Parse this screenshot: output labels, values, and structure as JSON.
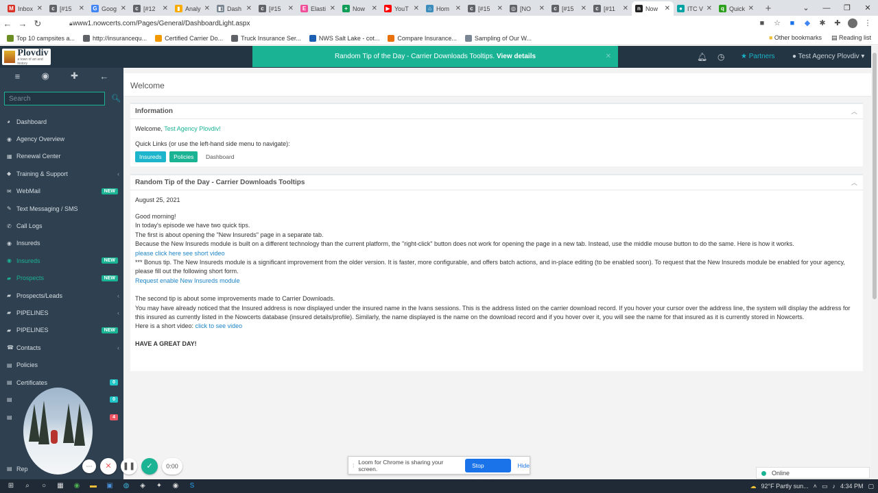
{
  "browser": {
    "tabs": [
      {
        "icon": "gmail-icon",
        "label": "Inbox",
        "color": "#d93025",
        "glyph": "M"
      },
      {
        "icon": "nowcerts-icon",
        "label": "[#15",
        "color": "#5f6368",
        "glyph": "c"
      },
      {
        "icon": "google-icon",
        "label": "Goog",
        "color": "#4285f4",
        "glyph": "G"
      },
      {
        "icon": "nowcerts-icon",
        "label": "[#12",
        "color": "#5f6368",
        "glyph": "c"
      },
      {
        "icon": "analytics-icon",
        "label": "Analy",
        "color": "#f9ab00",
        "glyph": "▮"
      },
      {
        "icon": "dashboard-icon",
        "label": "Dash",
        "color": "#7a8691",
        "glyph": "◧"
      },
      {
        "icon": "nowcerts-icon",
        "label": "[#15",
        "color": "#5f6368",
        "glyph": "c"
      },
      {
        "icon": "elastic-icon",
        "label": "Elasti",
        "color": "#f04e98",
        "glyph": "E"
      },
      {
        "icon": "sheets-icon",
        "label": "Now",
        "color": "#0f9d58",
        "glyph": "+"
      },
      {
        "icon": "youtube-icon",
        "label": "YouT",
        "color": "#ff0000",
        "glyph": "▶"
      },
      {
        "icon": "home-icon",
        "label": "Hom",
        "color": "#3c8dbc",
        "glyph": "⌂"
      },
      {
        "icon": "nowcerts-icon",
        "label": "[#15",
        "color": "#5f6368",
        "glyph": "c"
      },
      {
        "icon": "globe-icon",
        "label": "[NO",
        "color": "#5f6368",
        "glyph": "◎"
      },
      {
        "icon": "nowcerts-icon",
        "label": "[#15",
        "color": "#5f6368",
        "glyph": "c"
      },
      {
        "icon": "nowcerts-icon",
        "label": "[#11",
        "color": "#5f6368",
        "glyph": "c"
      },
      {
        "icon": "nowcerts-icon",
        "label": "Now",
        "color": "#222",
        "glyph": "n",
        "active": true
      },
      {
        "icon": "itc-icon",
        "label": "ITC V",
        "color": "#00a3a3",
        "glyph": "●"
      },
      {
        "icon": "quickbooks-icon",
        "label": "Quick",
        "color": "#2ca01c",
        "glyph": "q"
      }
    ],
    "url": "www1.nowcerts.com/Pages/General/DashboardLight.aspx",
    "bookmarks": [
      {
        "label": "Top 10 campsites a...",
        "color": "#6b8e23"
      },
      {
        "label": "http://insurancequ...",
        "color": "#5f6368"
      },
      {
        "label": "Certified Carrier Do...",
        "color": "#f29900"
      },
      {
        "label": "Truck Insurance Ser...",
        "color": "#5f6368"
      },
      {
        "label": "NWS Salt Lake - cot...",
        "color": "#1a5fb4"
      },
      {
        "label": "Compare Insurance...",
        "color": "#e8710a"
      },
      {
        "label": "Sampling of Our W...",
        "color": "#7a8691"
      }
    ],
    "bookmarks_right": {
      "other": "Other bookmarks",
      "reading": "Reading list"
    }
  },
  "header": {
    "logo_name": "Plovdiv",
    "logo_sub": "a town of art and history",
    "tip_text": "Random Tip of the Day - Carrier Downloads Tooltips.",
    "tip_link": "View details",
    "partners": "Partners",
    "agent": "Test Agency Plovdiv ▾"
  },
  "sidebar": {
    "search_placeholder": "Search",
    "items": [
      {
        "label": "Dashboard",
        "icon": "dashboard-icon",
        "glyph": "◕"
      },
      {
        "label": "Agency Overview",
        "icon": "globe-icon",
        "glyph": "◉"
      },
      {
        "label": "Renewal Center",
        "icon": "calendar-icon",
        "glyph": "▦"
      },
      {
        "label": "Training & Support",
        "icon": "graduation-icon",
        "glyph": "◆",
        "chev": true
      },
      {
        "label": "WebMail",
        "icon": "mail-icon",
        "glyph": "✉",
        "badge": "NEW"
      },
      {
        "label": "Text Messaging / SMS",
        "icon": "sms-icon",
        "glyph": "✎"
      },
      {
        "label": "Call Logs",
        "icon": "phone-icon",
        "glyph": "✆"
      },
      {
        "label": "Insureds",
        "icon": "eye-icon",
        "glyph": "◉"
      },
      {
        "label": "Insureds",
        "icon": "eye-icon",
        "glyph": "◉",
        "green": true,
        "badge": "NEW"
      },
      {
        "label": "Prospects",
        "icon": "folder-icon",
        "glyph": "▰",
        "green": true,
        "badge": "NEW"
      },
      {
        "label": "Prospects/Leads",
        "icon": "folder-icon",
        "glyph": "▰",
        "chev": true
      },
      {
        "label": "PIPELINES",
        "icon": "folder-icon",
        "glyph": "▰",
        "chev": true
      },
      {
        "label": "PIPELINES",
        "icon": "folder-icon",
        "glyph": "▰",
        "badge": "NEW"
      },
      {
        "label": "Contacts",
        "icon": "contacts-icon",
        "glyph": "☎",
        "chev": true
      },
      {
        "label": "Policies",
        "icon": "file-icon",
        "glyph": "▤"
      },
      {
        "label": "Certificates",
        "icon": "certificate-icon",
        "glyph": "▤",
        "count": "0"
      },
      {
        "label": "",
        "icon": "item-icon",
        "glyph": "▤",
        "count": "0"
      },
      {
        "label": "",
        "icon": "item-icon",
        "glyph": "▤",
        "count": "4",
        "red": true
      }
    ],
    "bottom_label": "Rep"
  },
  "page": {
    "title": "Welcome",
    "info_title": "Information",
    "welcome_prefix": "Welcome,",
    "welcome_name": "Test Agency Plovdiv!",
    "quicklinks_label": "Quick Links (or use the left-hand side menu to navigate):",
    "btn_insureds": "Insureds",
    "btn_policies": "Policies",
    "btn_dashboard": "Dashboard",
    "tip_title": "Random Tip of the Day - Carrier Downloads Tooltips",
    "date": "August 25, 2021",
    "greeting": "Good morning!",
    "p1": "In today's episode we have two quick tips.",
    "p2": "The first is about opening the \"New Insureds\" page in a separate tab.",
    "p3": "Because the New Insureds module is built on a different technology than the current platform, the \"right-click\" button does not work for opening the page in a new tab. Instead, use the middle mouse button to do the same. Here is how it works.",
    "link1": "please click here see short video",
    "p4": "*** Bonus tip. The New Insureds module is a significant improvement from the older version. It is faster, more configurable, and offers batch actions, and in-place editing (to be enabled soon). To request that the New Insureds module be enabled for your agency, please fill out the following short form.",
    "link2": "Request enable New Insureds module",
    "p5": "The second tip is about some improvements made to Carrier Downloads.",
    "p6": "You may have already noticed that the Insured address is now displayed under the insured name in the Ivans sessions. This is the address listed on the carrier download record. If you hover your cursor over the address line, the system will display the address for this insured as currently listed in the Nowcerts database (insured details/profile). Similarly, the name displayed is the name on the download record and if you hover over it, you will see the name for that insured as it is currently stored in Nowcerts.",
    "p7_prefix": "Here is a short video:",
    "link3": "click to see video",
    "closing": "HAVE A GREAT DAY!"
  },
  "recorder": {
    "timer": "0:00",
    "sharing_text": "Loom for Chrome is sharing your screen.",
    "stop": "Stop sharing",
    "hide": "Hide"
  },
  "status": {
    "online": "Online"
  },
  "taskbar": {
    "weather": "92°F  Partly sun...",
    "time": "4:34 PM"
  }
}
